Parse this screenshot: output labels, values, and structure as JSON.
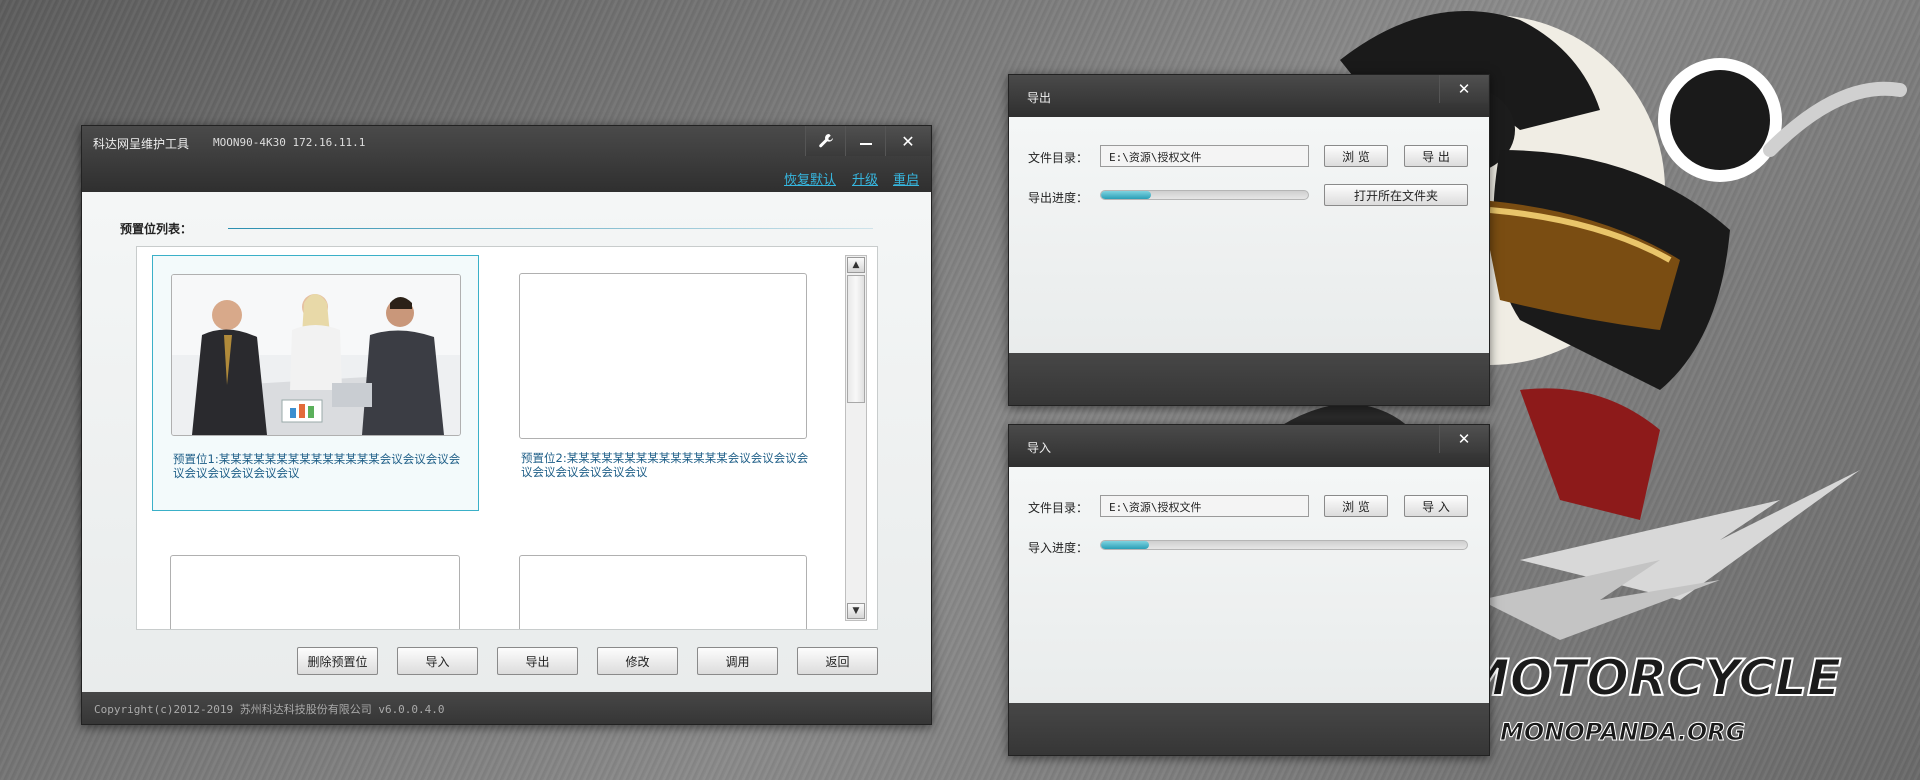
{
  "main_window": {
    "title": "科达网呈维护工具",
    "device": "MOON90-4K30 172.16.11.1",
    "links": {
      "restore_default": "恢复默认",
      "upgrade": "升级",
      "restart": "重启"
    },
    "section_label": "预置位列表：",
    "presets": [
      {
        "label": "预置位1:某某某某某某某某某某某某某某会议会议会议会议会议会议会议会议会议"
      },
      {
        "label": "预置位2:某某某某某某某某某某某某某某会议会议会议会议会议会议会议会议会议"
      },
      {
        "label": ""
      },
      {
        "label": ""
      }
    ],
    "buttons": {
      "delete": "删除预置位",
      "import": "导入",
      "export": "导出",
      "modify": "修改",
      "call": "调用",
      "back": "返回"
    },
    "copyright": "Copyright(c)2012-2019 苏州科达科技股份有限公司 v6.0.0.4.0"
  },
  "export_dialog": {
    "title": "导出",
    "dir_label": "文件目录：",
    "dir_value": "E:\\资源\\授权文件",
    "browse": "浏 览",
    "action": "导 出",
    "progress_label": "导出进度：",
    "progress": 0.24,
    "open_folder": "打开所在文件夹"
  },
  "import_dialog": {
    "title": "导入",
    "dir_label": "文件目录：",
    "dir_value": "E:\\资源\\授权文件",
    "browse": "浏 览",
    "action": "导 入",
    "progress_label": "导入进度：",
    "progress": 0.13
  },
  "wallpaper": {
    "text": "MOTORCYCLE",
    "subtext": "MONOPANDA.ORG"
  },
  "colors": {
    "accent": "#36b7e0",
    "progress": "#2a9fb7",
    "titlebar": "#3a3a3a"
  }
}
